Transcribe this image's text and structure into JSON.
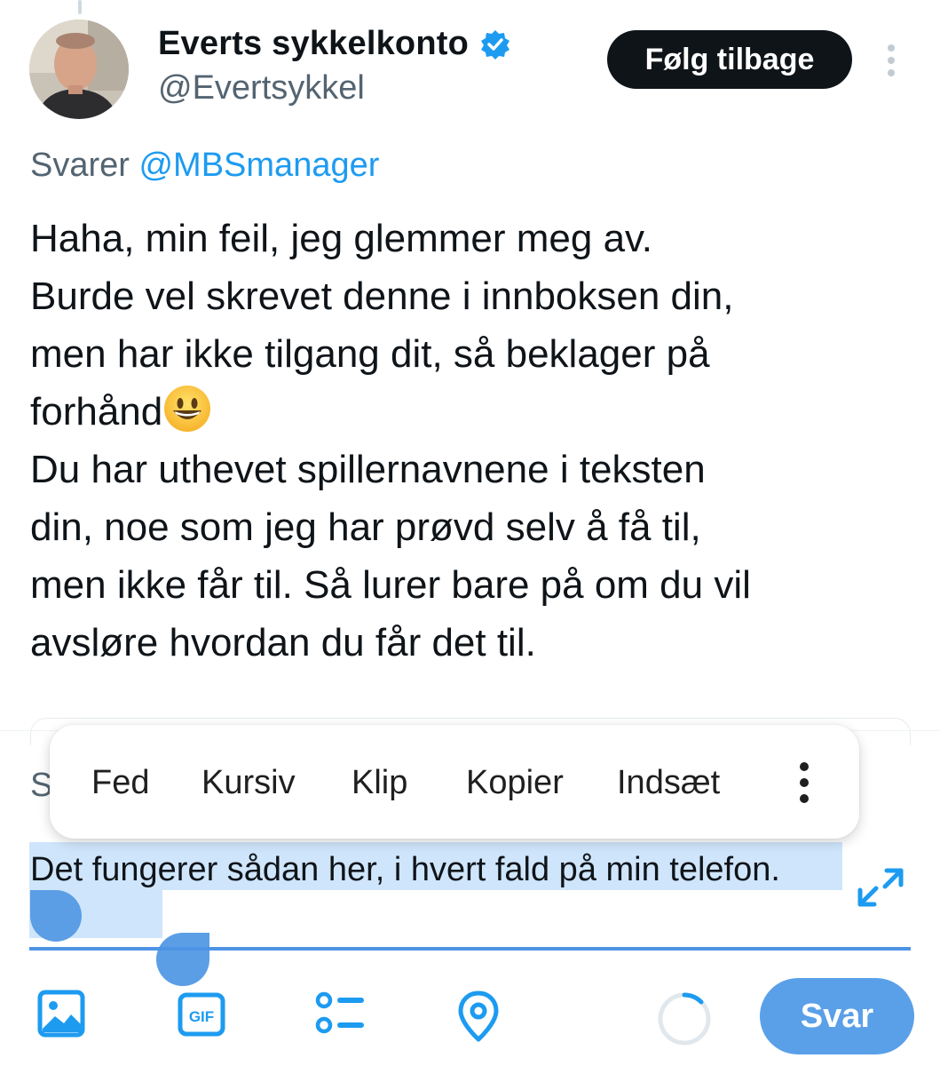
{
  "user": {
    "display_name": "Everts sykkelkonto",
    "handle": "@Evertsykkel",
    "verified_icon": "verified-badge-icon",
    "follow_label": "Følg tilbage"
  },
  "tweet": {
    "reply_prefix": "Svarer",
    "reply_mention": "@MBSmanager",
    "text_part1": "Haha, min feil, jeg glemmer meg av.\nBurde vel skrevet denne i innboksen din,\nmen har ikke tilgang dit, så beklager på\nforhånd",
    "emoji": "grinning-face-emoji",
    "text_part2": "\nDu har uthevet spillernavnene i teksten\ndin, noe som jeg har prøvd selv å få til,\nmen ikke får til. Så lurer bare på om du vil\navsløre hvordan du får det til."
  },
  "context_menu": {
    "items": [
      "Fed",
      "Kursiv",
      "Klip",
      "Kopier",
      "Indsæt"
    ],
    "more_icon": "more-vertical-icon"
  },
  "compose": {
    "placeholder_fragment": "S",
    "selected_text": "Det fungerer sådan her, i hvert fald på min telefon."
  },
  "toolbar": {
    "icons": [
      "image-icon",
      "gif-icon",
      "poll-icon",
      "location-icon"
    ],
    "reply_label": "Svar"
  },
  "colors": {
    "accent": "#1d9bf0",
    "follow_bg": "#0f1419",
    "reply_button": "#5aa0e8",
    "selection": "#cfe5fb",
    "handle": "#5b9ee6"
  }
}
